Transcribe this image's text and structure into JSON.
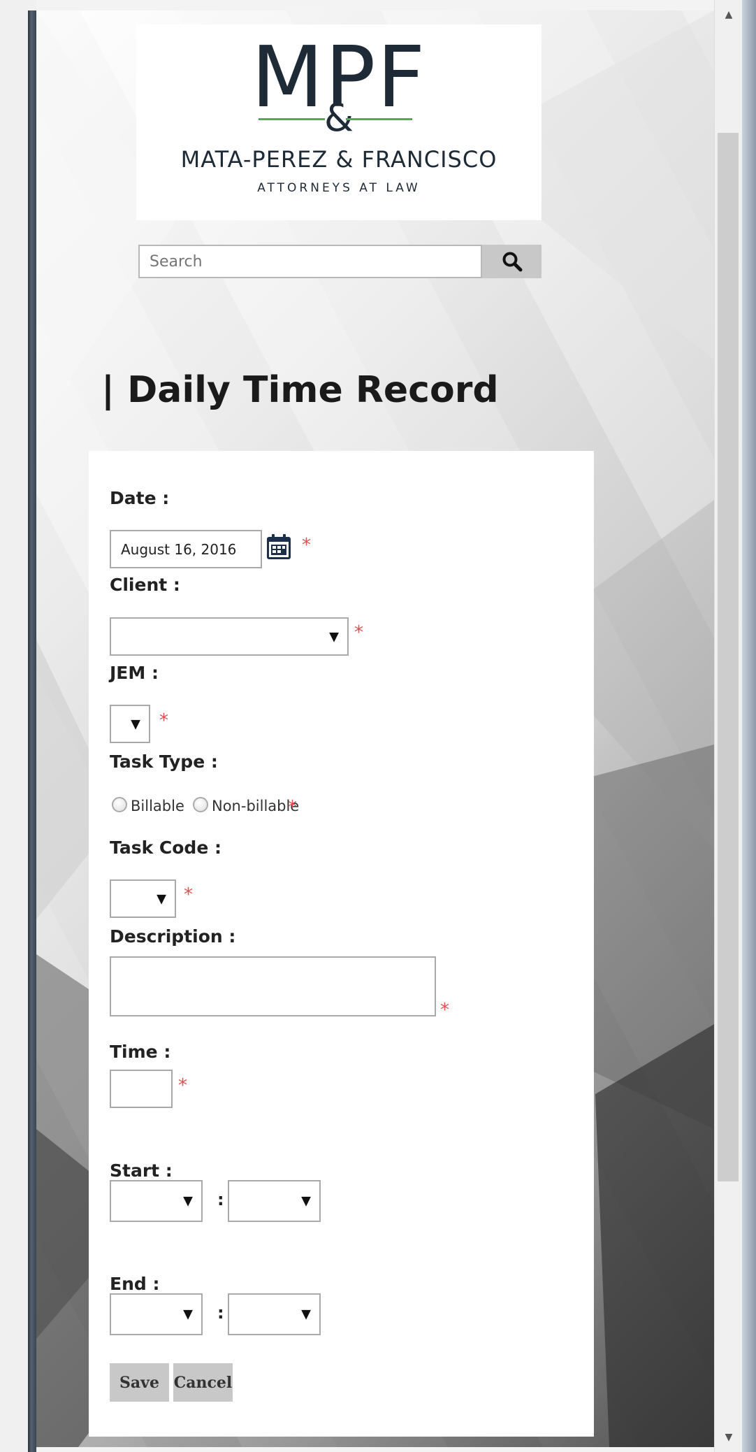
{
  "logo": {
    "mark": "MPF",
    "ampersand": "&",
    "firm_name": "MATA-PEREZ & FRANCISCO",
    "subtitle": "ATTORNEYS AT LAW",
    "accent_color": "#4caf50"
  },
  "search": {
    "placeholder": "Search",
    "icon": "search-icon"
  },
  "page": {
    "title": "| Daily Time Record"
  },
  "form": {
    "date": {
      "label": "Date :",
      "value": "August 16, 2016",
      "required_mark": "*",
      "icon": "calendar-icon"
    },
    "client": {
      "label": "Client :",
      "value": "",
      "required_mark": "*"
    },
    "jem": {
      "label": "JEM :",
      "value": "",
      "required_mark": "*"
    },
    "task_type": {
      "label": "Task Type :",
      "options": [
        "Billable",
        "Non-billable"
      ],
      "required_mark": "*"
    },
    "task_code": {
      "label": "Task Code :",
      "value": "",
      "required_mark": "*"
    },
    "description": {
      "label": "Description :",
      "value": "",
      "required_mark": "*"
    },
    "time": {
      "label": "Time :",
      "value": "",
      "required_mark": "*"
    },
    "start": {
      "label": "Start :",
      "separator": ":"
    },
    "end": {
      "label": "End :",
      "separator": ":"
    },
    "buttons": {
      "save": "Save",
      "cancel": "Cancel"
    }
  },
  "dropdown_arrow": "▼",
  "scrollbar": {
    "up": "▲",
    "down": "▼"
  }
}
